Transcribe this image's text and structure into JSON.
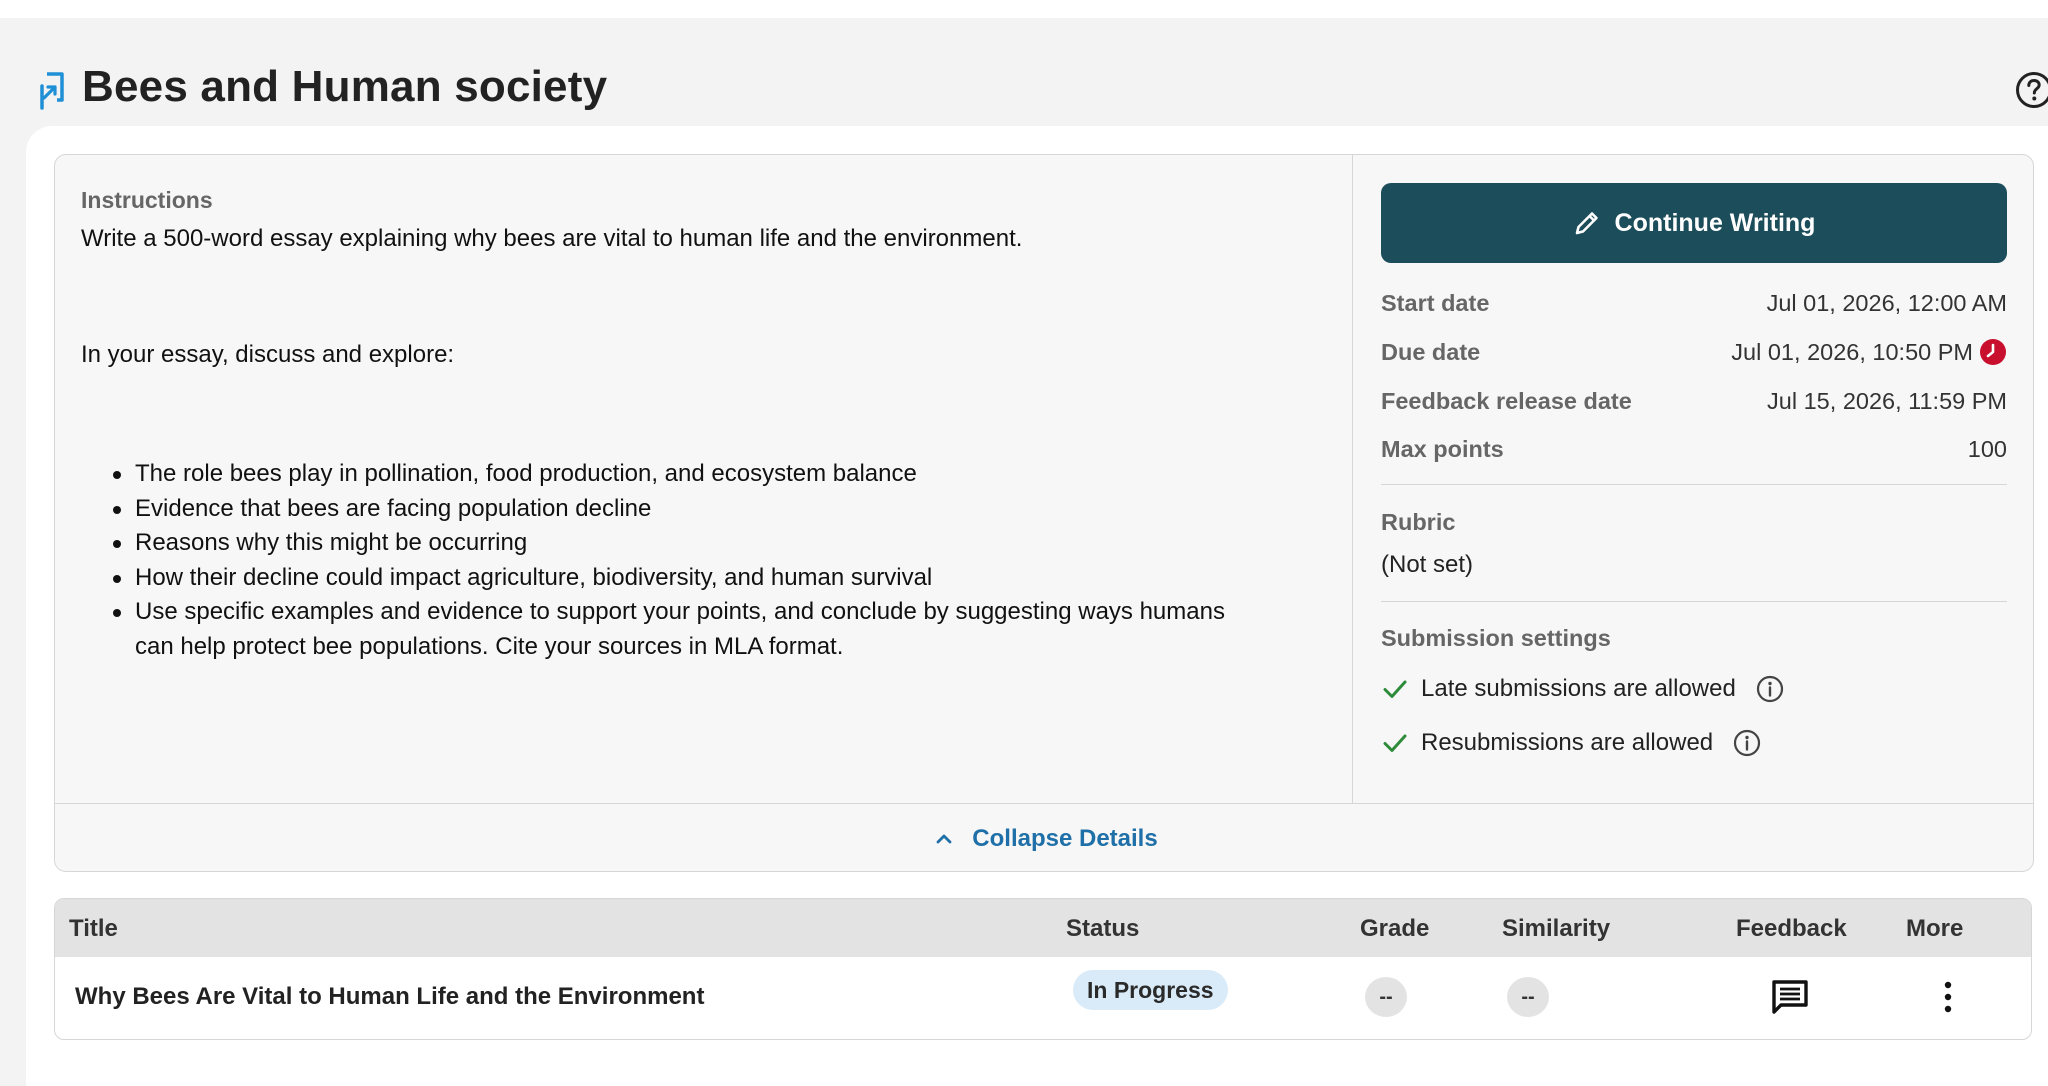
{
  "page": {
    "title": "Bees and Human society"
  },
  "instructions": {
    "label": "Instructions",
    "paragraph1": "Write a 500-word essay explaining why bees are vital to human life and the environment.",
    "paragraph2": "In your essay, discuss and explore:",
    "bullets": [
      "The role bees play in pollination, food production, and ecosystem balance",
      "Evidence that bees are facing population decline",
      "Reasons why this might be occurring",
      "How their decline could impact agriculture, biodiversity, and human survival",
      "Use specific examples and evidence to support your points, and conclude by suggesting ways humans",
      "can help protect bee populations. Cite your sources in MLA format."
    ]
  },
  "sidebar": {
    "continue_label": "Continue Writing",
    "start_date_label": "Start date",
    "start_date_value": "Jul 01, 2026, 12:00 AM",
    "due_date_label": "Due date",
    "due_date_value": "Jul 01, 2026, 10:50 PM",
    "feedback_release_label": "Feedback release date",
    "feedback_release_value": "Jul 15, 2026, 11:59 PM",
    "max_points_label": "Max points",
    "max_points_value": "100",
    "rubric_label": "Rubric",
    "rubric_value": "(Not set)",
    "submission_settings_label": "Submission settings",
    "late_submissions": "Late submissions are allowed",
    "resubmissions": "Resubmissions are allowed"
  },
  "collapse_label": "Collapse Details",
  "table": {
    "headers": {
      "title": "Title",
      "status": "Status",
      "grade": "Grade",
      "similarity": "Similarity",
      "feedback": "Feedback",
      "more": "More"
    },
    "rows": [
      {
        "title": "Why Bees Are Vital to Human Life and the Environment",
        "status": "In Progress",
        "grade": "--",
        "similarity": "--"
      }
    ]
  },
  "colors": {
    "primary_button": "#1c4d5a",
    "link": "#1f6fa8",
    "due_alert": "#c8102e",
    "check": "#2e8b3a",
    "status_badge": "#d9ebf8"
  },
  "icons": {
    "assignment": "assignment-icon",
    "help": "help-circle-icon",
    "pencil": "pencil-icon",
    "clock_alert": "clock-alert-icon",
    "check": "check-icon",
    "info": "info-icon",
    "chevron_up": "chevron-up-icon",
    "feedback": "comment-icon",
    "more": "more-vertical-icon"
  }
}
